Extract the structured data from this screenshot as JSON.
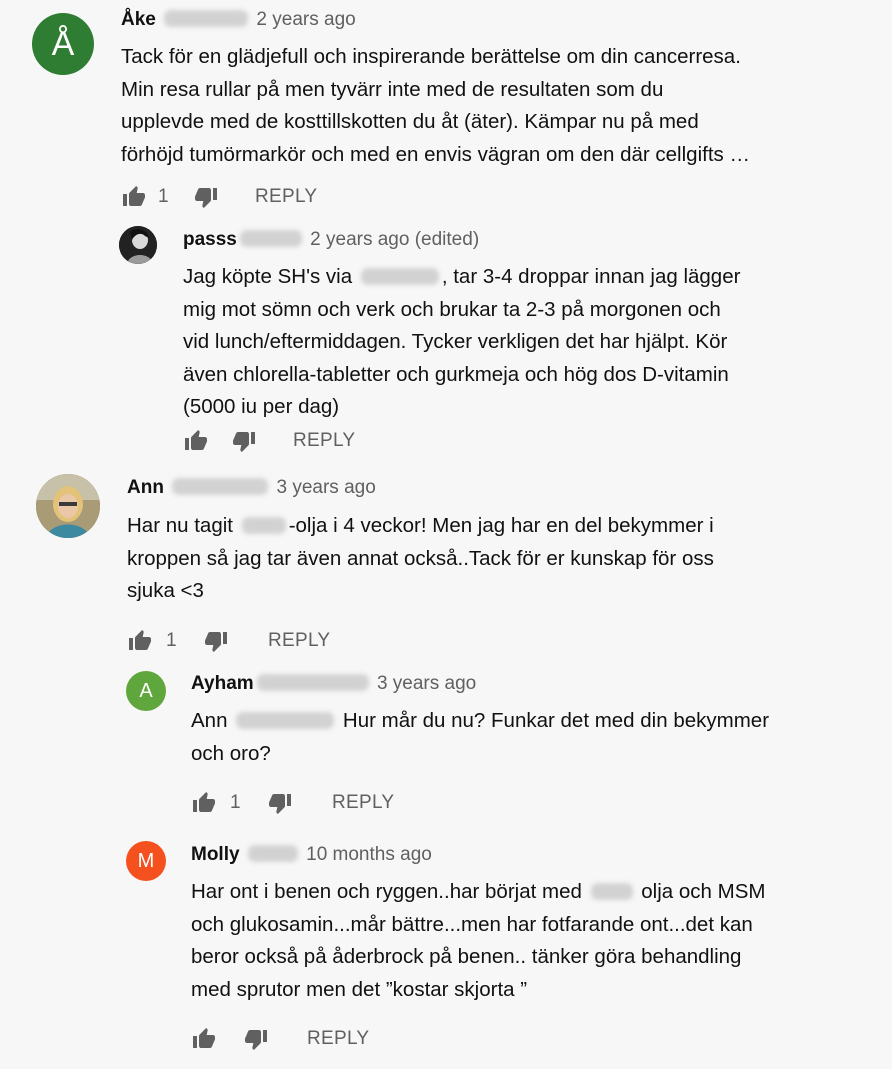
{
  "colors": {
    "background": "#f7f7f7",
    "avatar_ake": "#2e7d32",
    "avatar_ayham": "#5fa63d",
    "avatar_molly": "#f4511e",
    "icon": "#606060"
  },
  "comments": [
    {
      "avatar_letter": "Å",
      "author": "Åke",
      "time": "2 years ago",
      "lines": [
        "Tack för en glädjefull och inspirerande berättelse om din cancerresa.",
        "Min resa rullar på men tyvärr inte med de resultaten som du",
        "upplevde med de kosttillskotten du åt (äter). Kämpar nu på med",
        "förhöjd tumörmarkör och med en envis vägran om den där cellgifts …"
      ],
      "likes": "1",
      "reply_label": "REPLY"
    },
    {
      "avatar_letter": "",
      "author": "passs",
      "time": "2 years ago (edited)",
      "line1_pre": "Jag köpte SH's via",
      "line1_post": ", tar 3-4 droppar innan jag lägger",
      "lines": [
        "mig mot sömn och verk och brukar ta 2-3 på morgonen och",
        "vid lunch/eftermiddagen. Tycker verkligen det har hjälpt. Kör",
        "även chlorella-tabletter och gurkmeja och hög dos D-vitamin",
        "(5000 iu per dag)"
      ],
      "likes": "",
      "reply_label": "REPLY"
    },
    {
      "avatar_letter": "",
      "author": "Ann",
      "time": "3 years ago",
      "line1_pre": "Har nu tagit",
      "line1_post": "-olja i 4 veckor! Men jag har en del bekymmer i",
      "lines": [
        "kroppen så jag tar även annat också..Tack för er kunskap för oss",
        "sjuka <3"
      ],
      "likes": "1",
      "reply_label": "REPLY"
    },
    {
      "avatar_letter": "A",
      "author": "Ayham",
      "time": "3 years ago",
      "line1_pre": "Ann",
      "line1_post": "Hur mår du nu? Funkar det med din bekymmer",
      "lines": [
        "och oro?"
      ],
      "likes": "1",
      "reply_label": "REPLY"
    },
    {
      "avatar_letter": "M",
      "author": "Molly",
      "time": "10 months ago",
      "line1_pre": "Har ont i benen och ryggen..har börjat med",
      "line1_post": "olja och MSM",
      "lines": [
        "och glukosamin...mår bättre...men har fotfarande ont...det kan",
        "beror också på åderbrock på benen.. tänker göra behandling",
        "med sprutor men det ”kostar skjorta  ”"
      ],
      "likes": "",
      "reply_label": "REPLY"
    }
  ]
}
